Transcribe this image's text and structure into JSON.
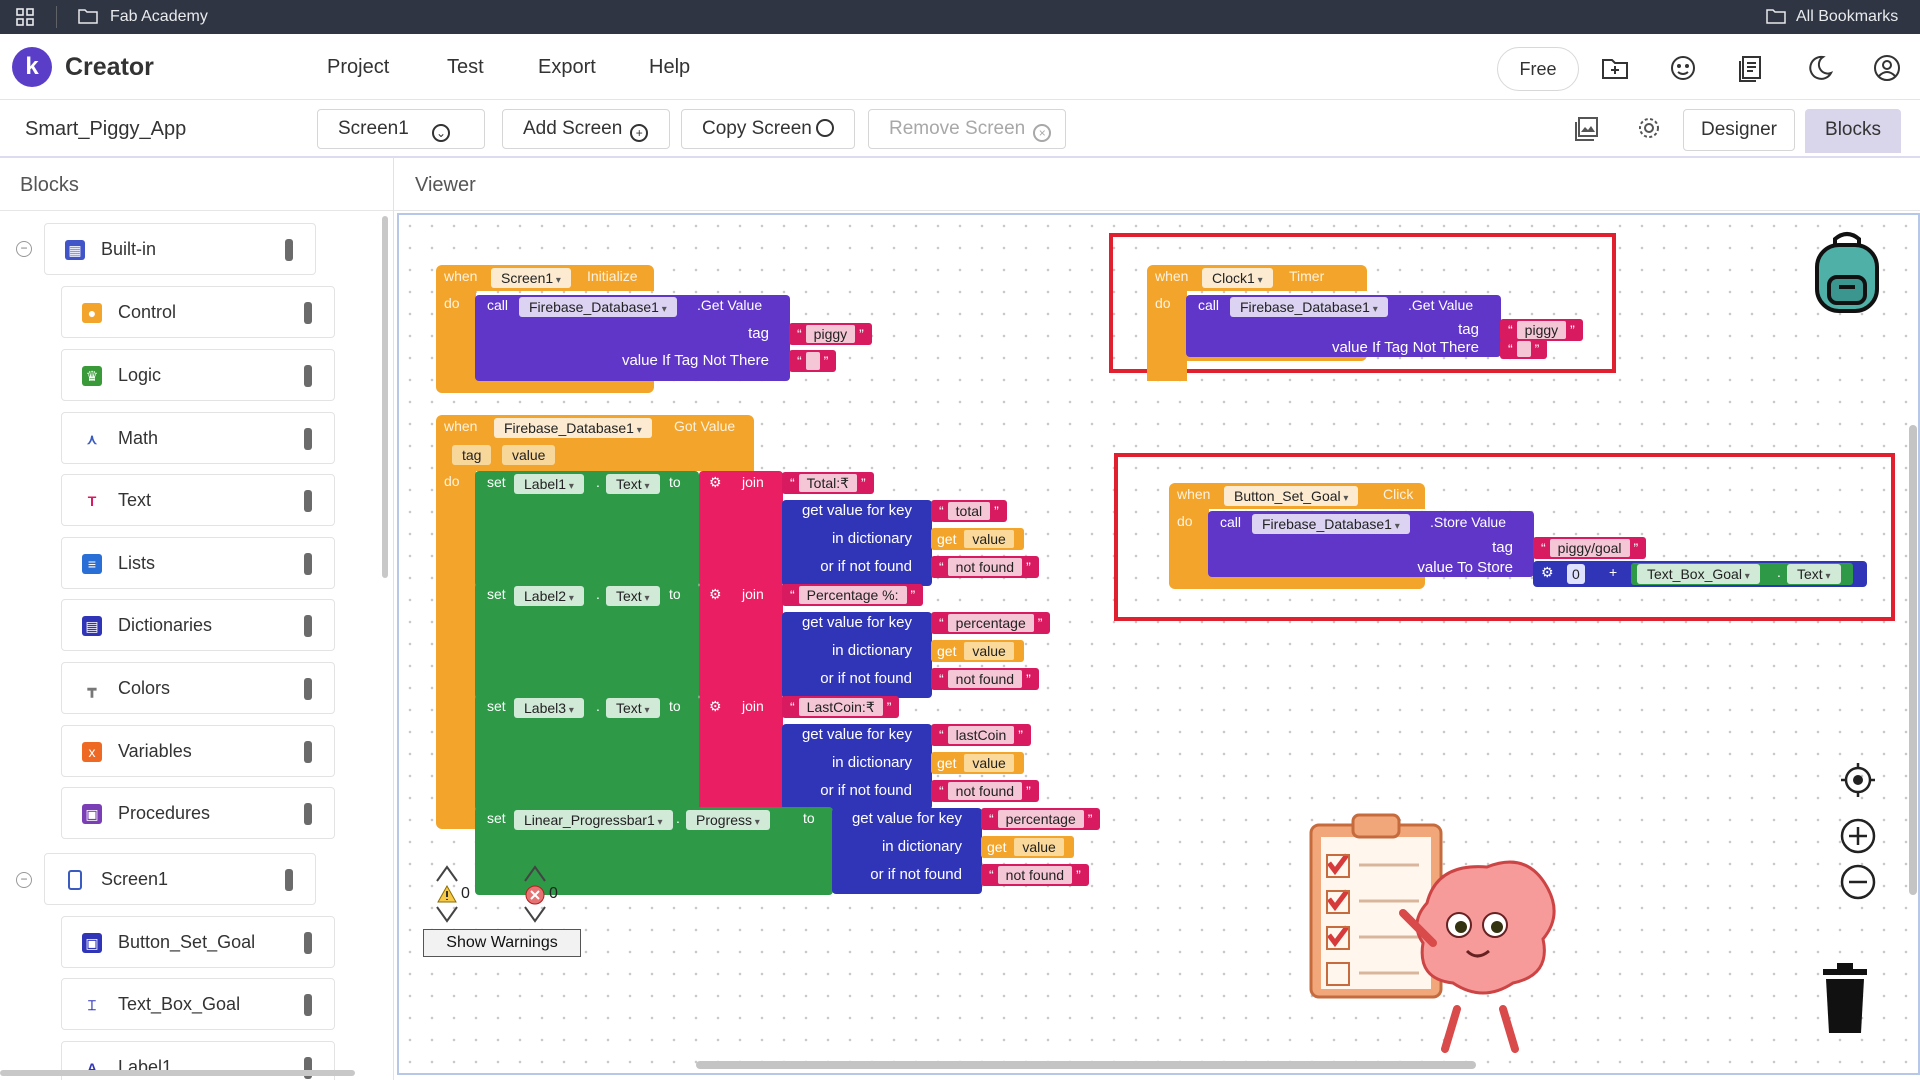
{
  "bookmarks_bar": {
    "folder": "Fab Academy",
    "all_bookmarks": "All Bookmarks"
  },
  "header": {
    "logo_letter": "k",
    "brand": "Creator",
    "menu": [
      "Project",
      "Test",
      "Export",
      "Help"
    ],
    "free_label": "Free"
  },
  "toolbar": {
    "project_name": "Smart_Piggy_App",
    "screen_select": "Screen1",
    "add_screen": "Add Screen",
    "copy_screen": "Copy Screen",
    "remove_screen": "Remove Screen",
    "designer": "Designer",
    "blocks": "Blocks"
  },
  "blocks_panel": {
    "title": "Blocks",
    "builtin": "Built-in",
    "builtin_items": [
      "Control",
      "Logic",
      "Math",
      "Text",
      "Lists",
      "Dictionaries",
      "Colors",
      "Variables",
      "Procedures"
    ],
    "screen": "Screen1",
    "screen_items": [
      "Button_Set_Goal",
      "Text_Box_Goal",
      "Label1"
    ]
  },
  "viewer": {
    "title": "Viewer"
  },
  "blocks_text": {
    "when": "when",
    "do": "do",
    "call": "call",
    "set": "set",
    "to": "to",
    "join": "join",
    "get": "get",
    "dot": ".",
    "plus": "+",
    "screen1": "Screen1",
    "initialize": "Initialize",
    "firebase": "Firebase_Database1",
    "get_value": ".Get Value",
    "tag": "tag",
    "value_if_not_there": "value If Tag Not There",
    "piggy": "piggy",
    "clock1": "Clock1",
    "timer": "Timer",
    "got_value": "Got Value",
    "param_tag": "tag",
    "param_value": "value",
    "label1": "Label1",
    "label2": "Label2",
    "label3": "Label3",
    "text_prop": "Text",
    "total": "Total:₹",
    "percentage_label": "Percentage %:",
    "lastcoin_label": "LastCoin:₹",
    "get_value_for_key": "get value for key",
    "in_dictionary": "in dictionary",
    "or_if_not_found": "or if not found",
    "key_total": "total",
    "key_percentage": "percentage",
    "key_lastcoin": "lastCoin",
    "value_var": "value",
    "not_found": "not found",
    "progressbar": "Linear_Progressbar1",
    "progress_prop": "Progress",
    "button_set_goal": "Button_Set_Goal",
    "click": "Click",
    "store_value": ".Store Value",
    "piggy_goal": "piggy/goal",
    "value_to_store": "value To Store",
    "zero": "0",
    "text_box_goal": "Text_Box_Goal"
  },
  "warnings": {
    "warning_count": "0",
    "error_count": "0",
    "show_warnings": "Show Warnings"
  },
  "colors": {
    "event_orange": "#f2a52a",
    "call_purple": "#6036c9",
    "setter_green": "#2e9a48",
    "text_pink": "#e91e63",
    "dict_blue": "#3035b8",
    "highlight_red": "#e0202e"
  },
  "icons": [
    "apps-grid-icon",
    "folder-icon",
    "folder-plus-icon",
    "gallery-icon",
    "docs-icon",
    "moon-icon",
    "account-icon",
    "image-icon",
    "gear-icon",
    "backpack-icon",
    "target-icon",
    "zoom-in-icon",
    "zoom-out-icon",
    "trash-icon"
  ]
}
